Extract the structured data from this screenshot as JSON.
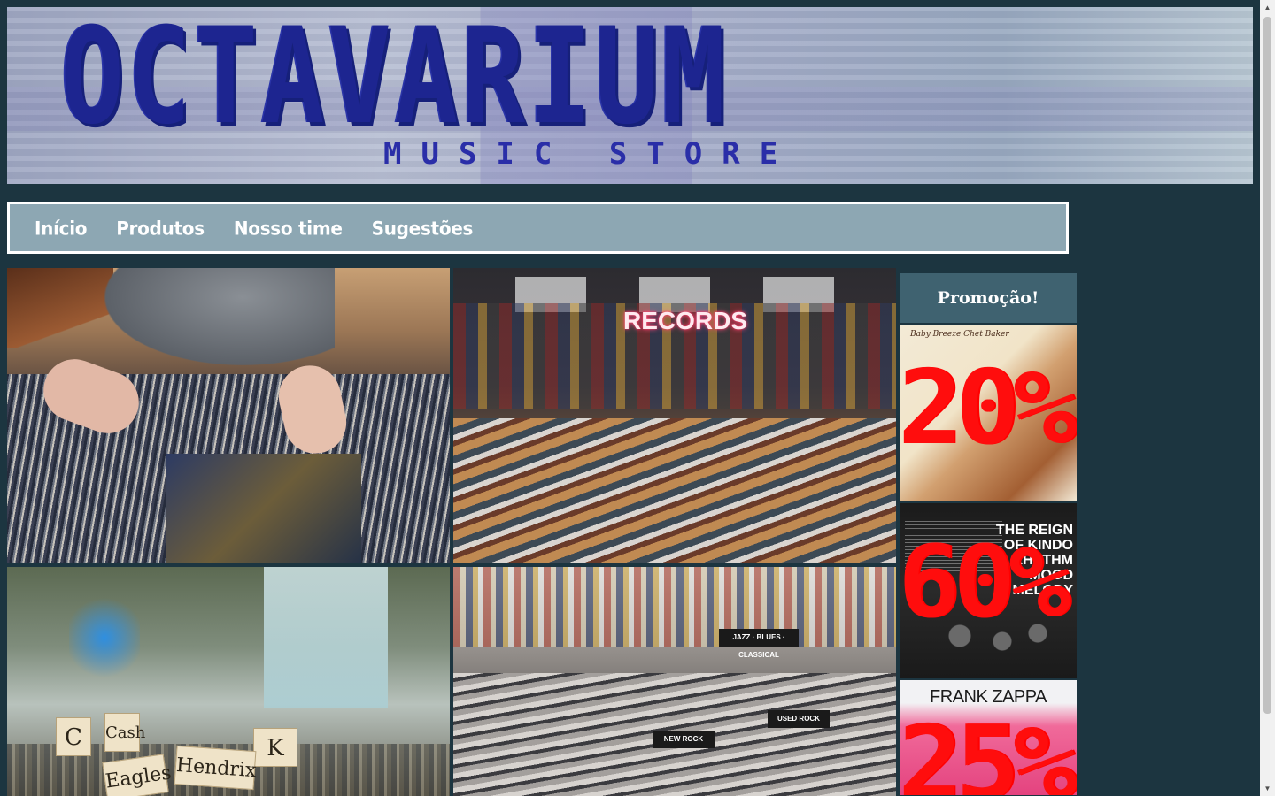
{
  "banner": {
    "title": "OCTAVARIUM",
    "subtitle": "MUSIC STORE"
  },
  "nav": {
    "items": [
      {
        "label": "Início"
      },
      {
        "label": "Produtos"
      },
      {
        "label": "Nosso time"
      },
      {
        "label": "Sugestões"
      }
    ]
  },
  "gallery": {
    "photo2_sign": "RECORDS",
    "photo3_dividers": [
      "C",
      "Cash",
      "K",
      "Eagles",
      "Hendrix"
    ],
    "photo4_signs": [
      "JAZZ · BLUES · CLASSICAL",
      "NEW ROCK",
      "USED ROCK"
    ]
  },
  "sidebar": {
    "title": "Promoção!",
    "promos": [
      {
        "cover_text": "Baby Breeze  Chet Baker",
        "discount": "20%"
      },
      {
        "cover_text": "THE REIGN OF KINDO RHYTHM MOOD MELODY",
        "discount": "60%"
      },
      {
        "cover_text": "FRANK ZAPPA",
        "discount": "25%"
      }
    ]
  },
  "colors": {
    "page_bg": "#1c3540",
    "nav_bg": "#8da7b3",
    "promo_header_bg": "#3f6270",
    "discount_red": "#ff0d0d",
    "logo_blue": "#1d2590"
  }
}
